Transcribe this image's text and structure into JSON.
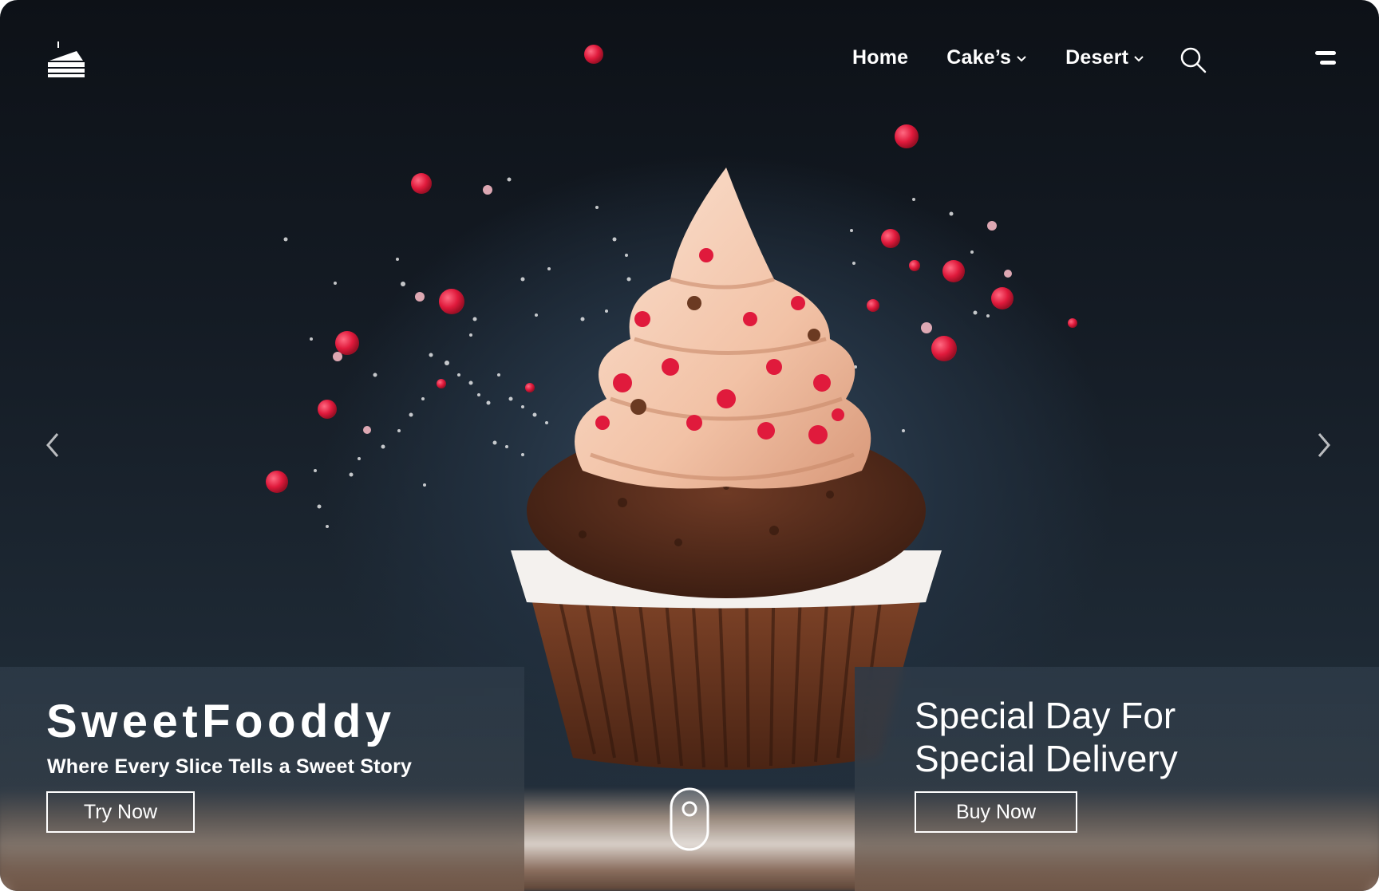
{
  "nav": {
    "items": [
      {
        "label": "Home",
        "has_dropdown": false
      },
      {
        "label": "Cake’s",
        "has_dropdown": true
      },
      {
        "label": "Desert",
        "has_dropdown": true
      }
    ],
    "icons": {
      "logo": "cake-slice-icon",
      "search": "search-icon",
      "menu": "menu-icon"
    }
  },
  "hero": {
    "brand": "SweetFooddy",
    "tagline": "Where Every Slice Tells a Sweet Story",
    "cta_primary": "Try Now",
    "special_heading_line1": "Special Day For",
    "special_heading_line2": "Special Delivery",
    "cta_secondary": "Buy Now"
  },
  "carousel": {
    "prev_icon": "chevron-left-icon",
    "next_icon": "chevron-right-icon",
    "scroll_indicator_icon": "mouse-scroll-icon"
  },
  "colors": {
    "background_dark": "#0d1117",
    "background_light": "#263340",
    "text": "#ffffff",
    "sprinkle": "#e01a3c"
  }
}
